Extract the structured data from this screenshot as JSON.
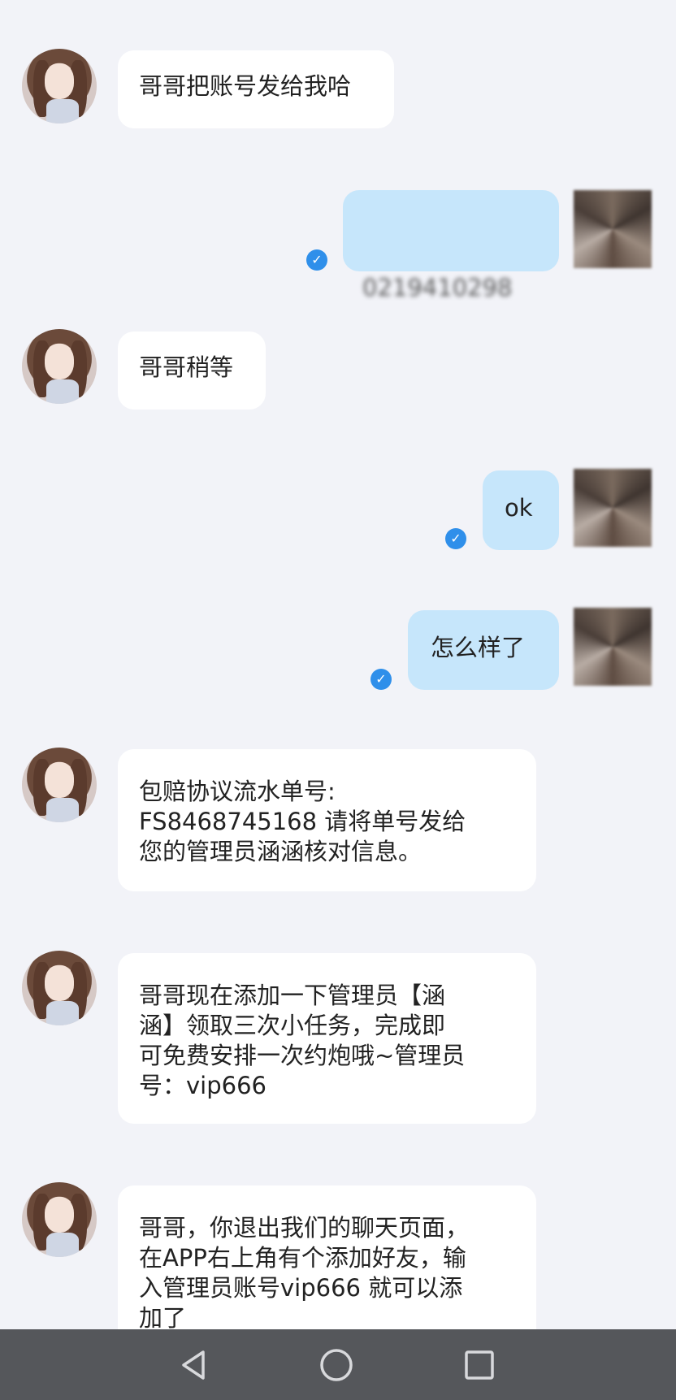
{
  "messages": [
    {
      "side": "in",
      "text": "哥哥把账号发给我哈"
    },
    {
      "side": "out",
      "text": "0219410298",
      "status": "read"
    },
    {
      "side": "in",
      "text": "哥哥稍等"
    },
    {
      "side": "out",
      "text": "ok",
      "status": "read"
    },
    {
      "side": "out",
      "text": "怎么样了",
      "status": "read"
    },
    {
      "side": "in",
      "text": "包赔协议流水单号:\nFS8468745168 请将单号发给\n您的管理员涵涵核对信息。"
    },
    {
      "side": "in",
      "text": "哥哥现在添加一下管理员【涵\n涵】领取三次小任务，完成即\n可免费安排一次约炮哦~管理员\n号：vip666"
    },
    {
      "side": "in",
      "text": "哥哥，你退出我们的聊天页面，\n在APP右上角有个添加好友，输\n入管理员账号vip666 就可以添\n加了"
    }
  ],
  "icons": {
    "read_check": "check-icon",
    "nav_back": "back-triangle-icon",
    "nav_home": "home-circle-icon",
    "nav_recent": "recent-square-icon"
  },
  "colors": {
    "background": "#f2f3f8",
    "incoming_bubble": "#ffffff",
    "outgoing_bubble": "#c6e6fb",
    "read_check": "#2f8fea",
    "nav_bar": "#55575b"
  }
}
